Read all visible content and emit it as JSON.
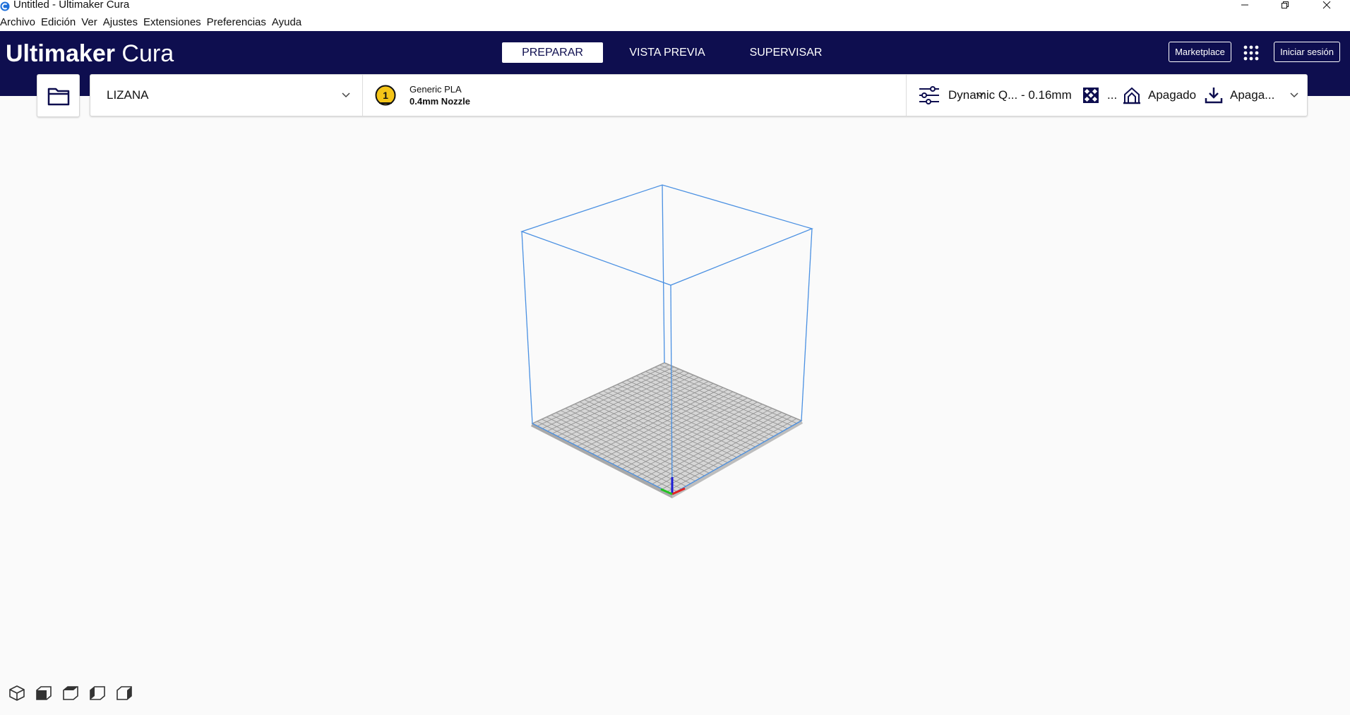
{
  "window": {
    "title": "Untitled - Ultimaker Cura"
  },
  "menu": {
    "items": [
      "Archivo",
      "Edición",
      "Ver",
      "Ajustes",
      "Extensiones",
      "Preferencias",
      "Ayuda"
    ]
  },
  "header": {
    "logo_bold": "Ultimaker",
    "logo_light": " Cura",
    "tabs": [
      {
        "label": "PREPARAR",
        "active": true
      },
      {
        "label": "VISTA PREVIA",
        "active": false
      },
      {
        "label": "SUPERVISAR",
        "active": false
      }
    ],
    "marketplace_label": "Marketplace",
    "signin_label": "Iniciar sesión"
  },
  "toolbar": {
    "printer_name": "LIZANA",
    "extruder_number": "1",
    "material": "Generic PLA",
    "nozzle": "0.4mm Nozzle",
    "profile": "Dynamic Q... - 0.16mm",
    "support": "...",
    "adhesion": "Apagado",
    "extra": "Apaga..."
  },
  "colors": {
    "header_bg": "#0e0e4f",
    "build_volume_lines": "#4a90e2",
    "extruder_badge": "#f5c518"
  },
  "view_buttons": [
    "3d-view-icon",
    "front-view-icon",
    "top-view-icon",
    "left-view-icon",
    "right-view-icon"
  ]
}
